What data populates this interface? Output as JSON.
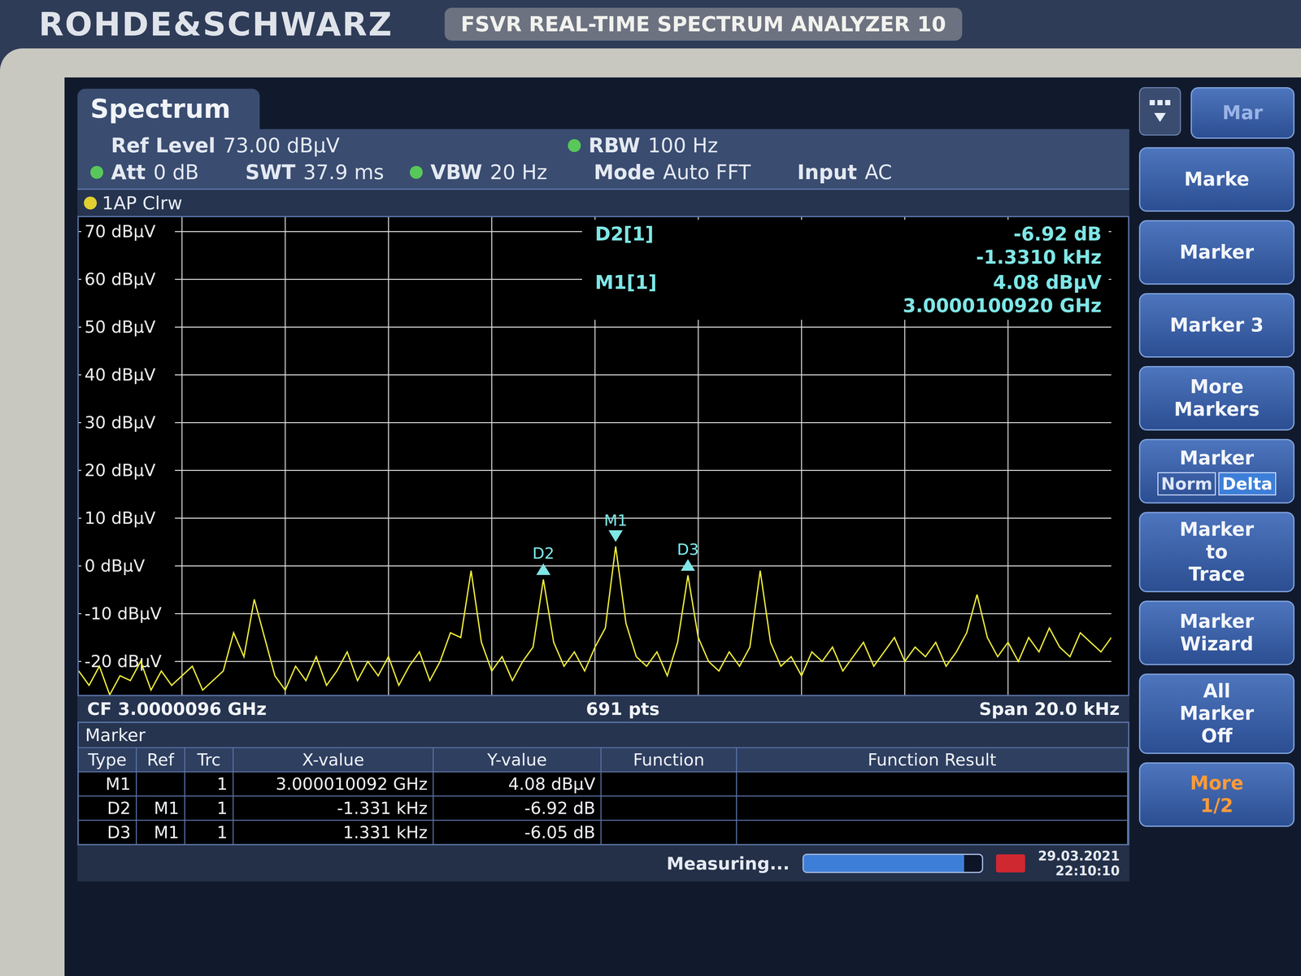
{
  "brand": {
    "logo": "ROHDE&SCHWARZ",
    "model": "FSVR  REAL-TIME SPECTRUM ANALYZER  10"
  },
  "tab": {
    "label": "Spectrum",
    "selected": true
  },
  "settings_rows": [
    [
      {
        "label": "Ref Level",
        "value": "73.00 dBµV",
        "indicator": false
      },
      {
        "label": "RBW",
        "value": "100 Hz",
        "indicator": true
      }
    ],
    [
      {
        "label": "Att",
        "value": "0 dB",
        "indicator": true
      },
      {
        "label": "SWT",
        "value": "37.9 ms",
        "indicator": false
      },
      {
        "label": "VBW",
        "value": "20 Hz",
        "indicator": true
      },
      {
        "label": "Mode",
        "value": "Auto FFT",
        "indicator": false
      },
      {
        "label": "Input",
        "value": "AC",
        "indicator": false
      }
    ]
  ],
  "trace_label": "1AP Clrw",
  "chart": {
    "y_ticks": [
      "70 dBµV",
      "60 dBµV",
      "50 dBµV",
      "40 dBµV",
      "30 dBµV",
      "20 dBµV",
      "10 dBµV",
      "0 dBµV",
      "-10 dBµV",
      "-20 dBµV"
    ],
    "trace": {
      "values": [
        -22,
        -25,
        -21,
        -27,
        -23,
        -24,
        -20,
        -26,
        -22,
        -25,
        -23,
        -21,
        -26,
        -24,
        -22,
        -14,
        -19,
        -7,
        -15,
        -23,
        -26,
        -21,
        -24,
        -19,
        -25,
        -22,
        -18,
        -24,
        -20,
        -23,
        -19,
        -25,
        -21,
        -18,
        -24,
        -20,
        -14,
        -15,
        -1,
        -16,
        -22,
        -19,
        -24,
        -20,
        -17,
        -2.84,
        -16,
        -21,
        -18,
        -22,
        -17,
        -13,
        4.08,
        -12,
        -19,
        -21,
        -18,
        -23,
        -16,
        -1.97,
        -15,
        -20,
        -22,
        -18,
        -21,
        -17,
        -1,
        -16,
        -21,
        -19,
        -23,
        -18,
        -20,
        -17,
        -22,
        -19,
        -16,
        -21,
        -18,
        -15,
        -20,
        -17,
        -19,
        -16,
        -21,
        -18,
        -14,
        -6,
        -15,
        -19,
        -16,
        -20,
        -15,
        -18,
        -13,
        -17,
        -19,
        -14,
        -16,
        -18,
        -15
      ]
    },
    "markers": [
      {
        "label": "M1",
        "point": 52,
        "kind": "down"
      },
      {
        "label": "D2",
        "point": 45,
        "kind": "up"
      },
      {
        "label": "D3",
        "point": 59,
        "kind": "up"
      }
    ],
    "readout": [
      {
        "label": "D2[1]",
        "lines": [
          "-6.92 dB",
          "-1.3310 kHz"
        ]
      },
      {
        "label": "M1[1]",
        "lines": [
          "4.08 dBµV",
          "3.0000100920 GHz"
        ]
      }
    ]
  },
  "footer": {
    "center": "CF 3.0000096 GHz",
    "points": "691 pts",
    "span": "Span 20.0 kHz"
  },
  "marker_table": {
    "title": "Marker",
    "columns": [
      "Type",
      "Ref",
      "Trc",
      "X-value",
      "Y-value",
      "Function",
      "Function Result"
    ],
    "rows": [
      [
        "M1",
        "",
        "1",
        "3.000010092 GHz",
        "4.08 dBµV",
        "",
        ""
      ],
      [
        "D2",
        "M1",
        "1",
        "-1.331 kHz",
        "-6.92 dB",
        "",
        ""
      ],
      [
        "D3",
        "M1",
        "1",
        "1.331 kHz",
        "-6.05 dB",
        "",
        ""
      ]
    ]
  },
  "status": {
    "message": "Measuring...",
    "level": 0.9,
    "date": "29.03.2021",
    "time": "22:10:10"
  },
  "softkeys": [
    {
      "kind": "tab",
      "lines": [
        "Mar"
      ]
    },
    {
      "kind": "key",
      "lines": [
        "Marke"
      ]
    },
    {
      "kind": "key",
      "lines": [
        "Marker"
      ]
    },
    {
      "kind": "key",
      "lines": [
        "Marker 3"
      ]
    },
    {
      "kind": "key",
      "lines": [
        "More",
        "Markers"
      ]
    },
    {
      "kind": "toggle",
      "lines": [
        "Marker"
      ],
      "options": [
        {
          "label": "Norm",
          "selected": false
        },
        {
          "label": "Delta",
          "selected": true
        }
      ]
    },
    {
      "kind": "key",
      "lines": [
        "Marker",
        "to",
        "Trace"
      ]
    },
    {
      "kind": "key",
      "lines": [
        "Marker",
        "Wizard"
      ]
    },
    {
      "kind": "key",
      "lines": [
        "All",
        "Marker",
        "Off"
      ]
    },
    {
      "kind": "more",
      "lines": [
        "More",
        "1/2"
      ]
    }
  ]
}
